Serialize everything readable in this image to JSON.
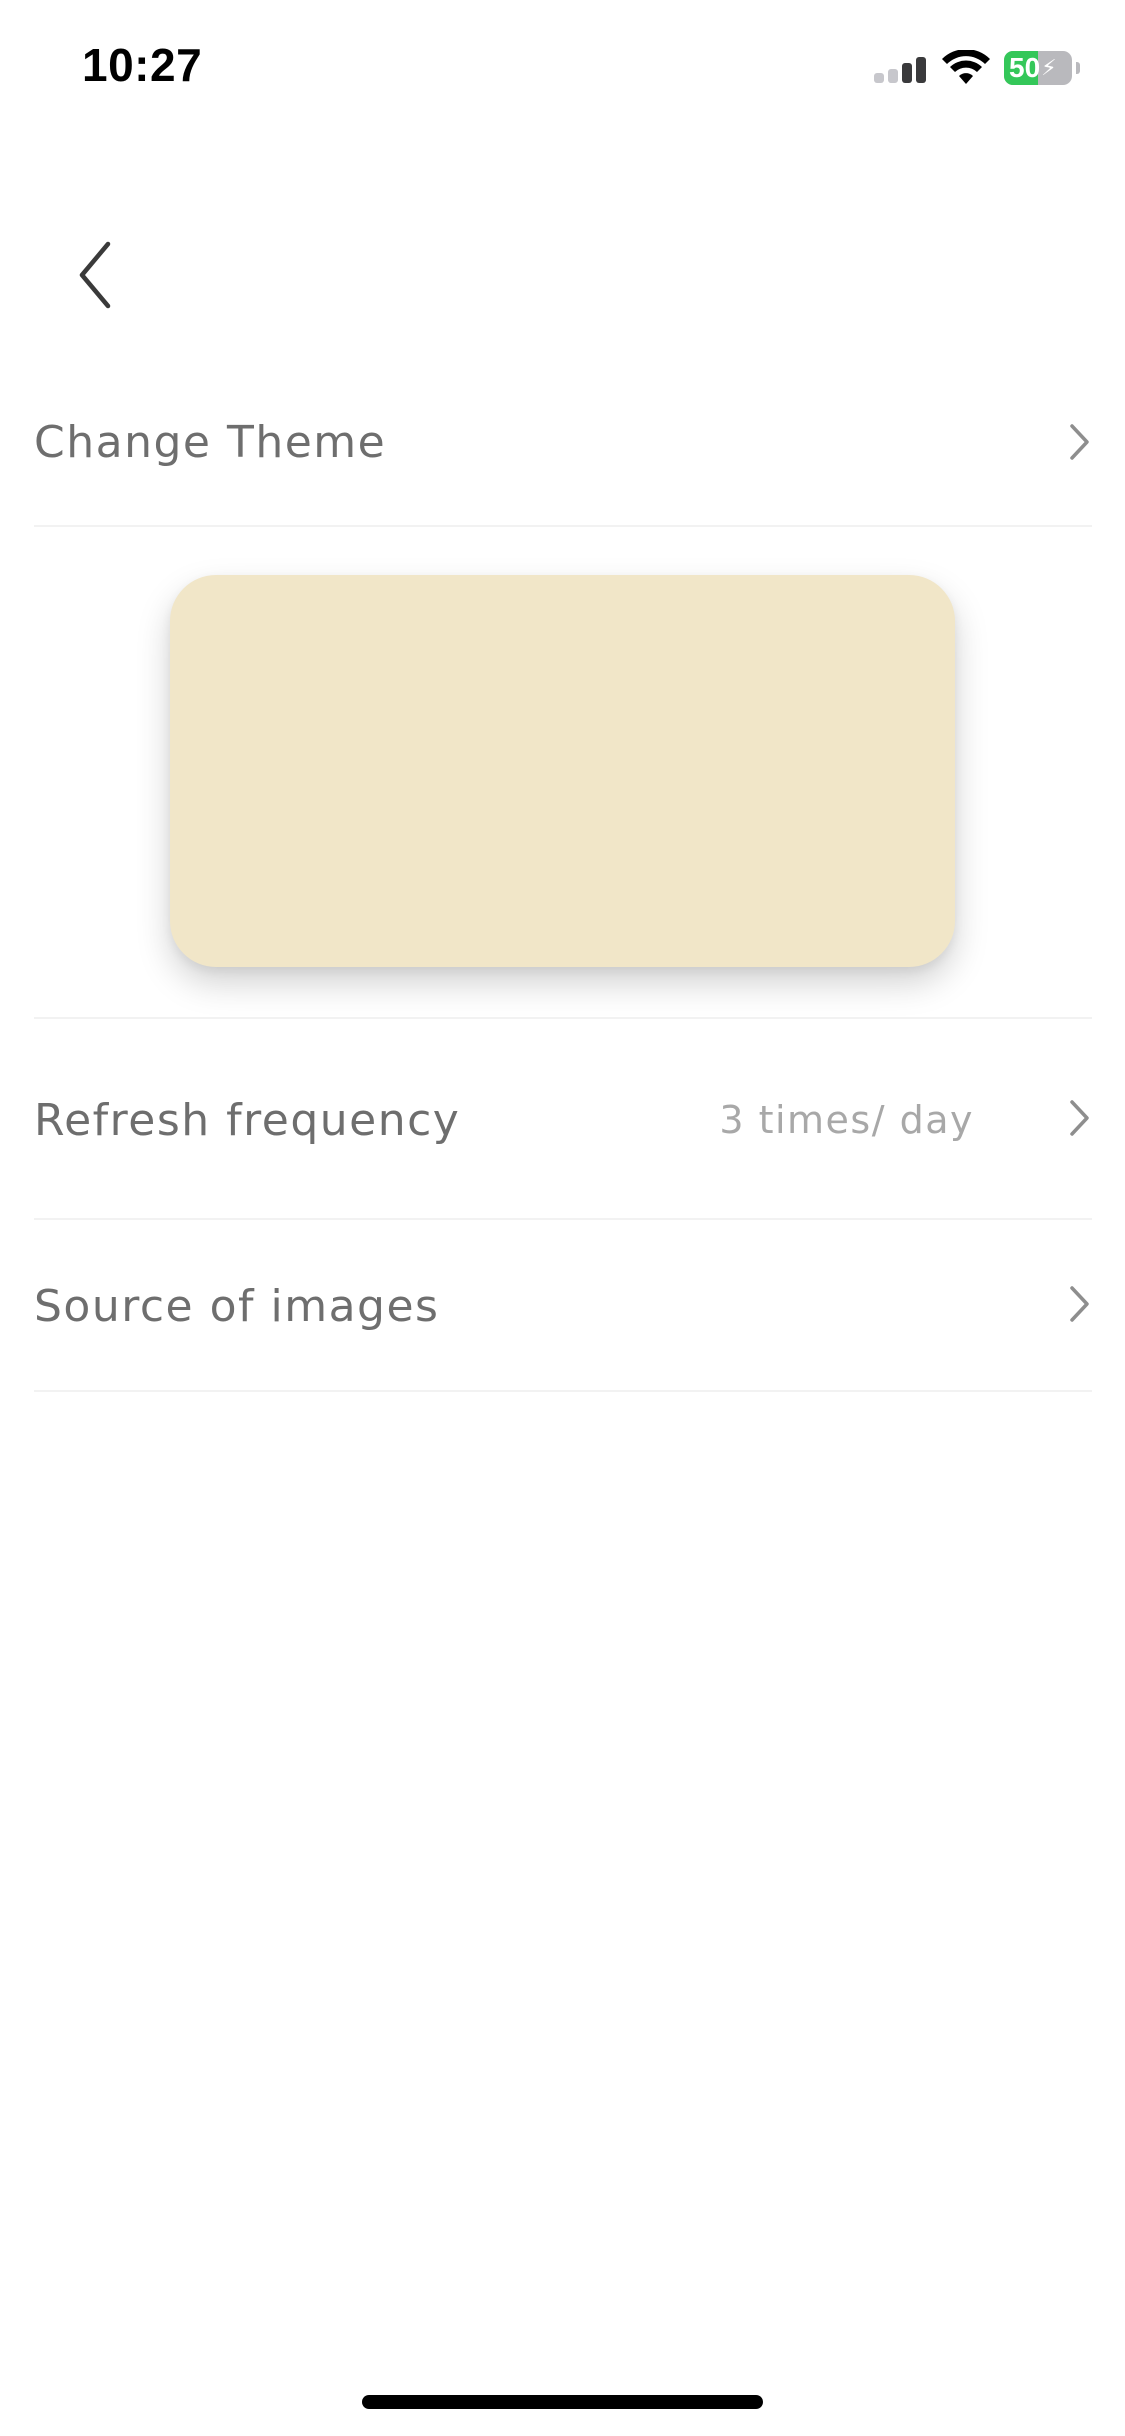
{
  "status_bar": {
    "time": "10:27",
    "battery_level": "50",
    "signal_icon": "cellular-signal-icon",
    "wifi_icon": "wifi-icon",
    "battery_icon": "battery-charging-icon"
  },
  "nav": {
    "back_icon": "chevron-left-icon"
  },
  "settings": {
    "change_theme_label": "Change Theme",
    "refresh_frequency_label": "Refresh frequency",
    "refresh_frequency_value": "3 times/ day",
    "source_of_images_label": "Source of images",
    "chevron_icon": "chevron-right-icon"
  },
  "theme_preview": {
    "color": "#f1e6c8"
  },
  "colors": {
    "battery_fill": "#34c759",
    "label_text": "#6e6e6e",
    "value_text": "#a8a8a8",
    "divider": "#f2f2f2"
  }
}
